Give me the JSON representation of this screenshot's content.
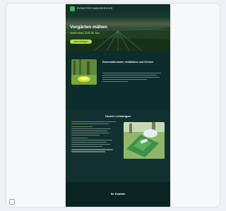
{
  "colors": {
    "site_background": "#0b2a2a",
    "accent_green": "#b6e04a",
    "hero_subtitle": "#a8d84e",
    "frame_background": "#f7f8fa"
  },
  "icons": {
    "corner": "expand-icon"
  },
  "site": {
    "logo_text": "ROBOTER MÄHSERVICE",
    "hero": {
      "title": "Vorgärten mähen",
      "subtitle": "Jetzt mehr Zeit für Sie",
      "cta_label": "Jetzt anfragen"
    },
    "promo": {
      "title": "Rasenmähroboter Installation und Service"
    },
    "services": {
      "title": "Unsere Leistungen"
    },
    "footer": {
      "title": "Ihr Kontakt"
    }
  }
}
